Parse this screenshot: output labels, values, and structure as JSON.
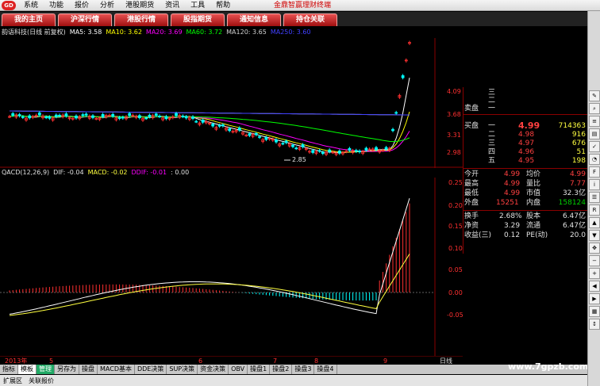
{
  "menubar": {
    "items": [
      "系统",
      "功能",
      "报价",
      "分析",
      "港股期货",
      "资讯",
      "工具",
      "帮助"
    ],
    "title": "金鼎智赢理财终端"
  },
  "tabs": [
    "我的主页",
    "沪深行情",
    "港股行情",
    "股指期货",
    "通知信息",
    "持仓关联"
  ],
  "stock_header": {
    "name": "韵语科技(日线 前复权)",
    "ma": [
      {
        "label": "MA5: 3.58",
        "color": "#ffffff"
      },
      {
        "label": "MA10: 3.62",
        "color": "#ffff00"
      },
      {
        "label": "MA20: 3.69",
        "color": "#ff00ff"
      },
      {
        "label": "MA60: 3.72",
        "color": "#00ff00"
      },
      {
        "label": "MA120: 3.65",
        "color": "#d0d0d0"
      },
      {
        "label": "MA250: 3.60",
        "color": "#4040ff"
      }
    ]
  },
  "macd_header": {
    "name": "QACD(12,26,9)",
    "dif": "DIF: -0.04",
    "macd": "MACD: -0.02",
    "ddif": "DDIF: -0.01",
    "extra": ": 0.00"
  },
  "price_axis": [
    "4.09",
    "3.68",
    "3.31",
    "2.98"
  ],
  "low_marker": "2.85",
  "macd_axis": [
    "0.25",
    "0.20",
    "0.15",
    "0.10",
    "0.05",
    "0.00",
    "-0.05"
  ],
  "date_axis": [
    "2013年",
    "5",
    "6",
    "7",
    "8",
    "9"
  ],
  "period_label": "日线",
  "orderbook": {
    "sell_label": "卖盘",
    "buy_label": "买盘",
    "sell": [
      {
        "lvl": "三",
        "price": "",
        "vol": ""
      },
      {
        "lvl": "二",
        "price": "",
        "vol": ""
      },
      {
        "lvl": "一",
        "price": "",
        "vol": ""
      }
    ],
    "buy": [
      {
        "lvl": "一",
        "price": "4.99",
        "vol": "714363"
      },
      {
        "lvl": "二",
        "price": "4.98",
        "vol": "916"
      },
      {
        "lvl": "三",
        "price": "4.97",
        "vol": "676"
      },
      {
        "lvl": "四",
        "price": "4.96",
        "vol": "51"
      },
      {
        "lvl": "五",
        "price": "4.95",
        "vol": "198"
      }
    ]
  },
  "quote": [
    {
      "l1": "今开",
      "v1": "4.99",
      "l2": "均价",
      "v2": "4.99"
    },
    {
      "l1": "最高",
      "v1": "4.99",
      "l2": "量比",
      "v2": "7.77"
    },
    {
      "l1": "最低",
      "v1": "4.99",
      "l2": "市值",
      "v2": "32.3亿"
    },
    {
      "l1": "外盘",
      "v1": "15251",
      "l2": "内盘",
      "v2": "158124"
    }
  ],
  "fundamentals": [
    {
      "l1": "换手",
      "v1": "2.68%",
      "l2": "股本",
      "v2": "6.47亿"
    },
    {
      "l1": "净资",
      "v1": "3.29",
      "l2": "流通",
      "v2": "6.47亿"
    },
    {
      "l1": "收益(三)",
      "v1": "0.12",
      "l2": "PE(动)",
      "v2": "20.0"
    }
  ],
  "bottom_tabs": [
    "指标",
    "模板",
    "管理",
    "另存为",
    "操盘",
    "MACD基本",
    "DDE决策",
    "SUP决策",
    "资金决策",
    "OBV",
    "操盘1",
    "操盘2",
    "操盘3",
    "操盘4"
  ],
  "status": [
    "扩展区",
    "关联报价"
  ],
  "watermark": "www.7gpzb.com",
  "toolbar_icons": [
    "pen-icon",
    "zoom-icon",
    "lines-icon",
    "chart-icon",
    "tick-icon",
    "gauge-icon",
    "f10-icon",
    "info-icon",
    "list-icon",
    "rsi-icon",
    "up-icon",
    "down-icon",
    "move-icon",
    "minus-icon",
    "plus-icon",
    "left-icon",
    "right-icon",
    "grid-icon",
    "arrow-icon"
  ],
  "colors": {
    "ma5": "#ffffff",
    "ma10": "#ffff00",
    "ma20": "#ff00ff",
    "ma60": "#00ff00",
    "ma120": "#d0d0d0",
    "ma250": "#4040ff",
    "up": "#ff3030",
    "down": "#00ffff"
  }
}
